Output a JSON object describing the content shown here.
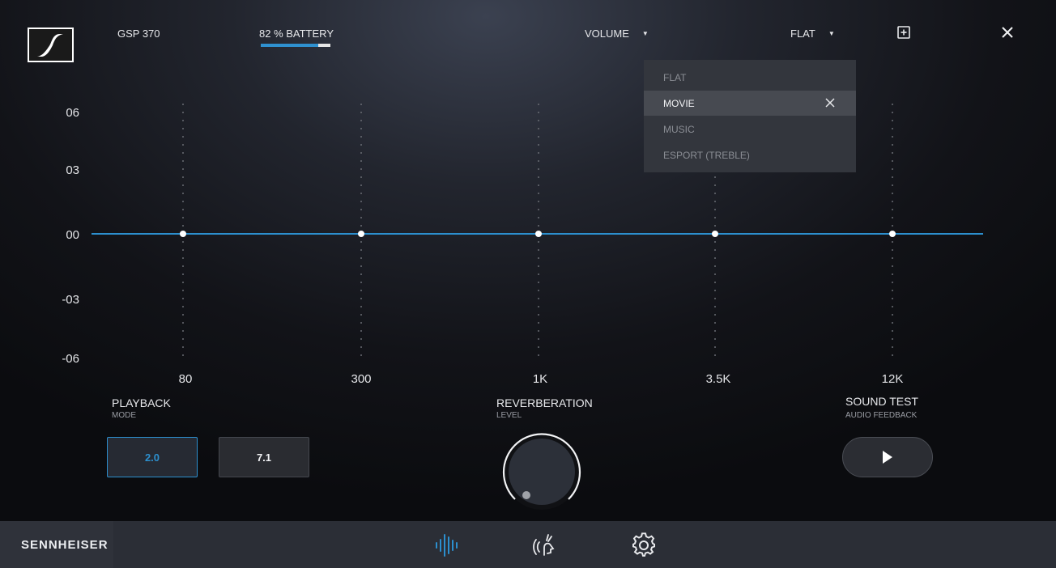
{
  "header": {
    "model": "GSP 370",
    "battery_label": "82 % BATTERY",
    "battery_level": 0.82,
    "volume_label": "VOLUME",
    "preset_label": "FLAT"
  },
  "equalizer": {
    "y_labels": [
      "06",
      "03",
      "00",
      "-03",
      "-06"
    ],
    "bands": [
      {
        "label": "80",
        "gain": 0
      },
      {
        "label": "300",
        "gain": 0
      },
      {
        "label": "1K",
        "gain": 0
      },
      {
        "label": "3.5K",
        "gain": 0
      },
      {
        "label": "12K",
        "gain": 0
      }
    ]
  },
  "preset_menu": {
    "items": [
      "FLAT",
      "MOVIE",
      "MUSIC",
      "ESPORT (TREBLE)"
    ],
    "selected": "MOVIE"
  },
  "playback": {
    "title": "PLAYBACK",
    "subtitle": "MODE",
    "options": [
      "2.0",
      "7.1"
    ],
    "selected": "2.0"
  },
  "reverberation": {
    "title": "REVERBERATION",
    "subtitle": "LEVEL",
    "level": 0
  },
  "sound_test": {
    "title": "SOUND TEST",
    "subtitle": "AUDIO FEEDBACK"
  },
  "bottom_bar": {
    "brand": "SENNHEISER",
    "nav_icons": [
      "equalizer-icon",
      "microphone-voice-icon",
      "gear-icon"
    ],
    "active": "equalizer-icon"
  },
  "colors": {
    "accent": "#2c8fce",
    "panel": "#33363d",
    "bottom_bar": "#2b2e36"
  }
}
